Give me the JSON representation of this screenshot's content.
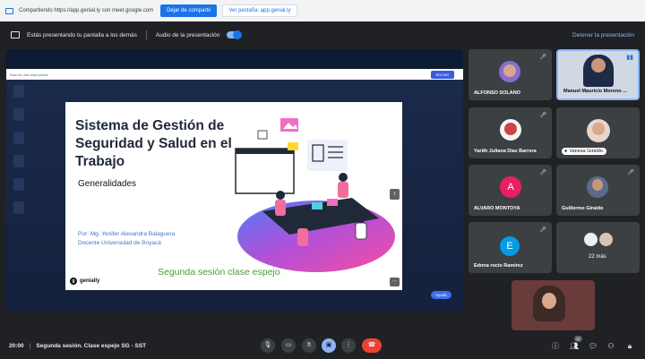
{
  "share_bar": {
    "text": "Compartiendo https://app.genial.ly con meet.google.com",
    "stop_label": "Dejar de compartir",
    "switch_label": "Ver pestaña: app.genial.ly"
  },
  "presenting_bar": {
    "text": "Estás presentando tu pantalla a los demás",
    "audio_label": "Audio de la presentación",
    "stop_label": "Detener la presentación"
  },
  "genially": {
    "view_notice": "Esto es una vista previa",
    "edit_label": "EDITAR",
    "help_label": "Ayuda",
    "next_icon": "›",
    "menu_icon": "···"
  },
  "slide": {
    "title": "Sistema de Gestión de Seguridad y Salud en el Trabajo",
    "subtitle": "Generalidades",
    "author_line1": "Por: Mg. Yenifer Alexandra Balaguera",
    "author_line2": "Docente Universidad de Boyacá",
    "session": "Segunda sesión clase espejo",
    "logo_text": "genially"
  },
  "participants": [
    {
      "name": "ALFONSO SOLANO"
    },
    {
      "name": "Manuel Mauricio Moreno ..."
    },
    {
      "name": "Yarith Juliana Díaz Barrera"
    },
    {
      "name": "Vanesa Giraldo."
    },
    {
      "name": "ALVARO MONTOYA",
      "initial": "A",
      "color": "#e91e63"
    },
    {
      "name": "Guillermo Giraldo"
    },
    {
      "name": "Ednna rocio Ramirez",
      "initial": "E",
      "color": "#039be5"
    },
    {
      "name": "22 más"
    }
  ],
  "bottom_bar": {
    "time": "20:00",
    "separator": "|",
    "meeting_name": "Segunda sesión. Clase espejo SG - SST",
    "people_count": "31"
  },
  "colors": {
    "meet_bg": "#202124",
    "tile_bg": "#3c4043",
    "accent": "#1a73e8",
    "end_call": "#ea4335"
  }
}
